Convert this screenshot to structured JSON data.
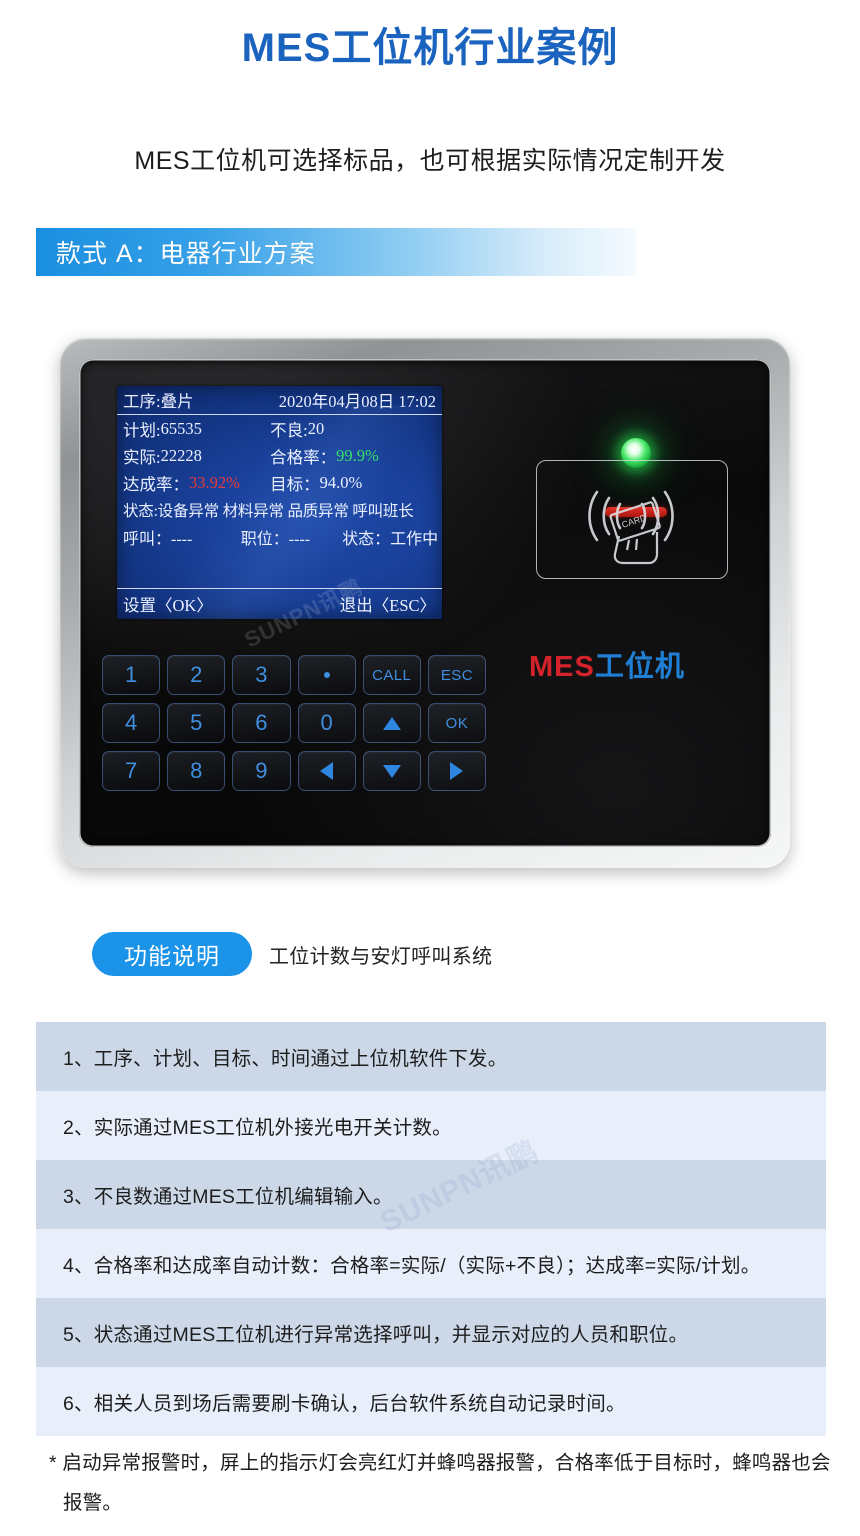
{
  "title": "MES工位机行业案例",
  "subtitle": "MES工位机可选择标品，也可根据实际情况定制开发",
  "section": {
    "label": "款式 A：电器行业方案"
  },
  "colors": {
    "title_blue": "#1a64bf",
    "accent_blue": "#1a93e8",
    "bar_gradient_start": "#1a8fe0",
    "bar_gradient_end": "#f4fbff",
    "lcd_blue": "#19409a",
    "lcd_green": "#35e06a",
    "lcd_red": "#e8393c",
    "brand_red": "#d4232a",
    "brand_blue": "#1f7fd4",
    "led_green": "#49e869",
    "red_bar": "#c42119",
    "row_odd": "#ccd8e8",
    "row_even": "#e9effa"
  },
  "device": {
    "lcd": {
      "header": {
        "process_label": "工序:",
        "process_value": "叠片",
        "datetime": "2020年04月08日 17:02"
      },
      "rows": [
        {
          "left_label": "计划:",
          "left_value": "65535",
          "right_label": "不良:",
          "right_value": "20"
        },
        {
          "left_label": "实际:",
          "left_value": "22228",
          "right_label": "合格率：",
          "right_value": "99.9%",
          "right_color": "green"
        },
        {
          "left_label": "达成率：",
          "left_value": "33.92%",
          "left_color": "red",
          "right_label": "目标：",
          "right_value": "94.0%"
        }
      ],
      "status_line": "状态:设备异常 材料异常 品质异常 呼叫班长",
      "call_line": {
        "call_label": "呼叫：",
        "call_value": "----",
        "post_label": "职位：",
        "post_value": "----",
        "state_label": "状态：",
        "state_value": "工作中"
      },
      "footer": {
        "settings": "设置〈OK〉",
        "exit": "退出〈ESC〉"
      }
    },
    "keypad": [
      {
        "label": "1",
        "type": "digit"
      },
      {
        "label": "2",
        "type": "digit"
      },
      {
        "label": "3",
        "type": "digit"
      },
      {
        "label": "·",
        "type": "dot"
      },
      {
        "label": "CALL",
        "type": "text"
      },
      {
        "label": "ESC",
        "type": "text"
      },
      {
        "label": "4",
        "type": "digit"
      },
      {
        "label": "5",
        "type": "digit"
      },
      {
        "label": "6",
        "type": "digit"
      },
      {
        "label": "0",
        "type": "digit"
      },
      {
        "label": "▲",
        "type": "arrow-up"
      },
      {
        "label": "OK",
        "type": "text"
      },
      {
        "label": "7",
        "type": "digit"
      },
      {
        "label": "8",
        "type": "digit"
      },
      {
        "label": "9",
        "type": "digit"
      },
      {
        "label": "◀",
        "type": "arrow-left"
      },
      {
        "label": "▼",
        "type": "arrow-down"
      },
      {
        "label": "▶",
        "type": "arrow-right"
      }
    ],
    "rfid": {
      "icon": "rfid-card-swipe-icon",
      "card_text": "CARD"
    },
    "brand": {
      "mes": "MES",
      "cn": "工位机"
    },
    "led": {
      "indicator": "green-status-led",
      "bar": "red-alarm-bar"
    },
    "watermark": "SUNPN讯鹏"
  },
  "function": {
    "pill_label": "功能说明",
    "text": "工位计数与安灯呼叫系统"
  },
  "list_items": [
    "1、工序、计划、目标、时间通过上位机软件下发。",
    "2、实际通过MES工位机外接光电开关计数。",
    "3、不良数通过MES工位机编辑输入。",
    "4、合格率和达成率自动计数：合格率=实际/（实际+不良）；达成率=实际/计划。",
    "5、状态通过MES工位机进行异常选择呼叫，并显示对应的人员和职位。",
    "6、相关人员到场后需要刷卡确认，后台软件系统自动记录时间。"
  ],
  "footnote": "* 启动异常报警时，屏上的指示灯会亮红灯并蜂鸣器报警，合格率低于目标时，蜂鸣器也会报警。",
  "page_watermark": "SUNPN讯鹏"
}
